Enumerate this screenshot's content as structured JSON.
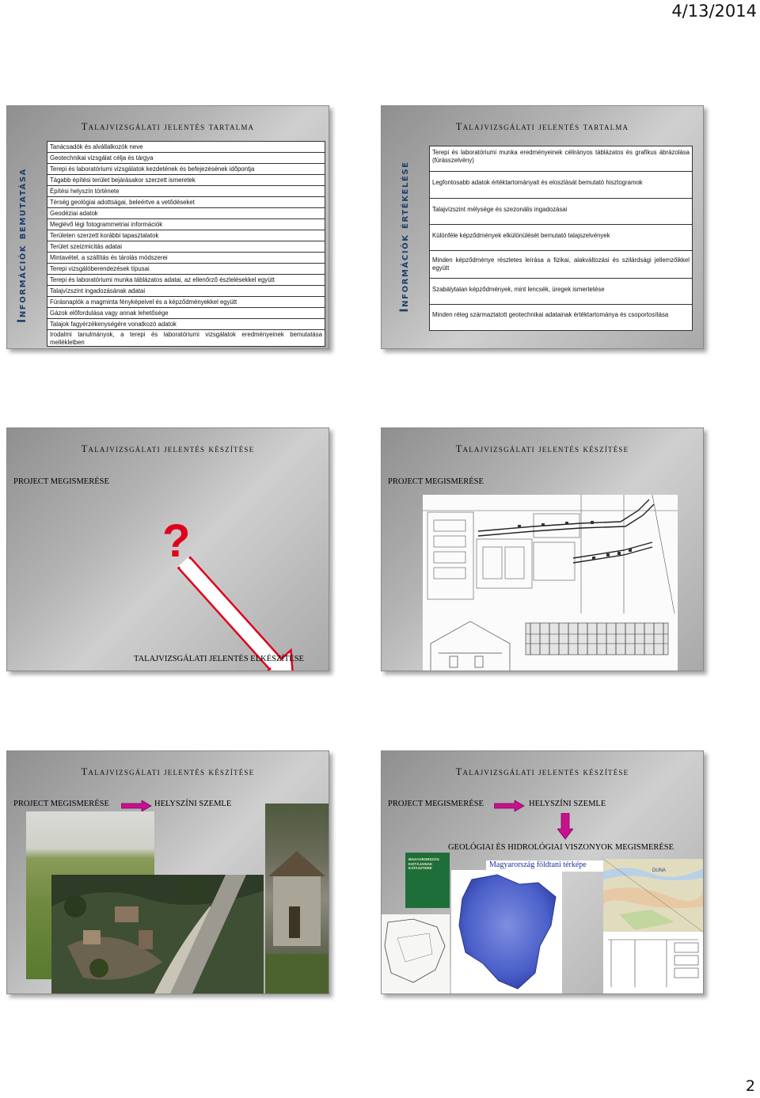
{
  "header": {
    "date": "4/13/2014"
  },
  "footer": {
    "page_number": "2"
  },
  "slide1": {
    "title": "Talajvizsgálati jelentés tartalma",
    "side_label": "Információk bemutatása",
    "rows": [
      "Tanácsadók és alvállalkozók neve",
      "Geotechnikai vizsgálat célja és tárgya",
      "Terepi és laboratóriumi vizsgálatok kezdetének és befejezésének időpontja",
      "Tágabb építési terület bejárásakor szerzett ismeretek",
      "Építési helyszín története",
      "Térség geológiai adottságai, beleértve a vetődéseket",
      "Geodéziai adatok",
      "Meglévő légi fotogrammetriai információk",
      "Területen szerzett korábbi tapasztalatok",
      "Terület szeizmicitás adatai",
      "Mintavétel, a szállítás és tárolás módszerei",
      "Terepi vizsgálóberendezések típusai",
      "Terepi és laboratóriumi munka táblázatos adatai, az ellenőrző észlelésekkel együtt",
      "Talajvízszint ingadozásának adatai",
      "Fúrásnaplók a magminta fényképeivel és a képződményekkel együtt",
      "Gázok előfordulása vagy annak lehetősége",
      "Talajok fagyérzékenységére vonatkozó adatok",
      "Irodalmi tanulmányok, a terepi és laboratóriumi vizsgálatok eredményeinek bemutatása mellékletben"
    ]
  },
  "slide2": {
    "title": "Talajvizsgálati jelentés tartalma",
    "side_label": "Információk értékelése",
    "rows": [
      "Terepi és laboratóriumi munka eredményeinek célirányos táblázatos és grafikus ábrázolása (fúrásszelvény)",
      "Legfontosabb adatok értéktartományait és eloszlását bemutató hisztogramok",
      "Talajvízszint mélysége és szezonális ingadozásai",
      "Különféle képződmények elkülönülését bemutató talajszelvények",
      "Minden képződménye részletes leírása a fizikai, alakváltozási és szilárdsági jellemzőikkel együtt",
      "Szabálytalan képződmények, mint lencsék, üregek ismertetése",
      "Minden réteg származtatott geotechnikai adatainak értéktartománya és csoportosítása"
    ]
  },
  "slide3": {
    "title": "Talajvizsgálati jelentés készítése",
    "subtitle": "PROJECT MEGISMERÉSE",
    "question_mark": "?",
    "bottom_label": "TALAJVIZSGÁLATI JELENTÉS ELKÉSZÍTÉSE",
    "colors": {
      "question": "#e0001b",
      "arrow": "#e0001b"
    }
  },
  "slide4": {
    "title": "Talajvizsgálati jelentés készítése",
    "subtitle": "PROJECT MEGISMERÉSE"
  },
  "slide5": {
    "title": "Talajvizsgálati jelentés készítése",
    "subtitle": "PROJECT MEGISMERÉSE",
    "subtitle2": "HELYSZÍNI SZEMLE",
    "colors": {
      "arrow": "#c9108e"
    }
  },
  "slide6": {
    "title": "Talajvizsgálati jelentés készítése",
    "subtitle": "PROJECT MEGISMERÉSE",
    "subtitle2": "HELYSZÍNI SZEMLE",
    "subtitle3": "GEOLÓGIAI ÉS HIDROLÓGIAI VISZONYOK MEGISMERÉSE",
    "book_title": "MAGYARORSZÁG KISTÁJAINAK KATASZTERE",
    "map_title": "Magyarország földtani térképe",
    "map_region_label": "DUNA",
    "colors": {
      "arrow": "#c9108e",
      "map_fill": "#4a5fc9"
    }
  }
}
